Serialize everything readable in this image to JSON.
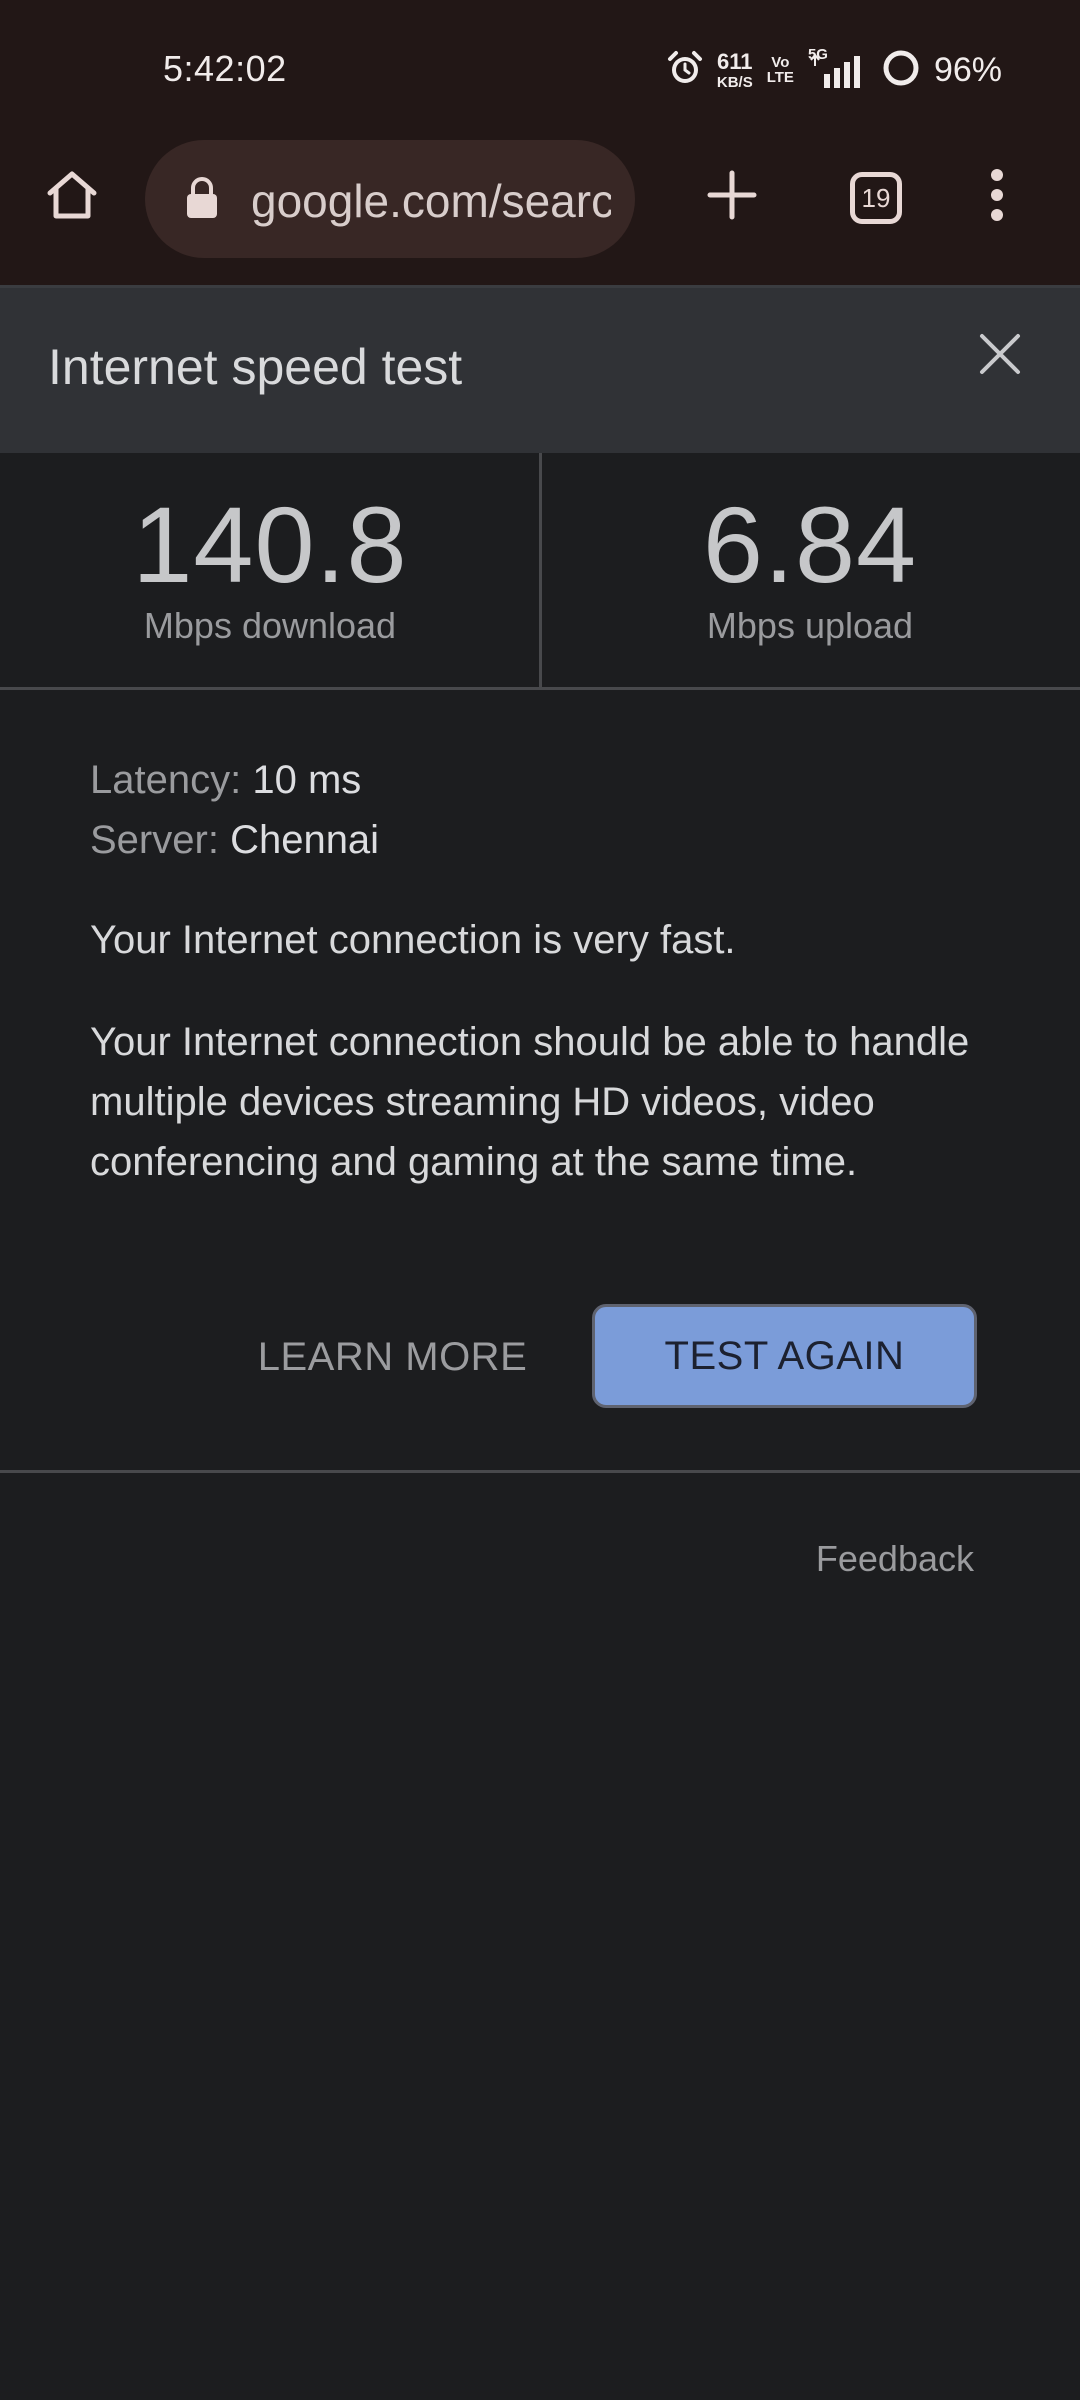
{
  "status_bar": {
    "time": "5:42:02",
    "net_speed_value": "611",
    "net_speed_unit": "KB/S",
    "volte_top": "Vo",
    "volte_bottom": "LTE",
    "network": "5G",
    "battery_percent": "96%",
    "icons": [
      "alarm-icon",
      "volte-icon",
      "signal-icon",
      "battery-ring-icon"
    ]
  },
  "toolbar": {
    "url": "google.com/search",
    "tab_count": "19",
    "icons": [
      "home-icon",
      "lock-icon",
      "new-tab-plus-icon",
      "more-vertical-icon"
    ]
  },
  "card": {
    "title": "Internet speed test",
    "download": {
      "value": "140.8",
      "label": "Mbps download"
    },
    "upload": {
      "value": "6.84",
      "label": "Mbps upload"
    },
    "latency_label": "Latency:",
    "latency_value": "10 ms",
    "server_label": "Server:",
    "server_value": "Chennai",
    "summary": "Your Internet connection is very fast.",
    "description": "Your Internet connection should be able to handle multiple devices streaming HD videos, video conferencing and gaming at the same time.",
    "learn_more": "LEARN MORE",
    "test_again": "TEST AGAIN",
    "feedback": "Feedback"
  },
  "colors": {
    "status_bg": "#221716",
    "urlbar_bg": "#382725",
    "card_header_bg": "#303236",
    "page_bg": "#1c1d1f",
    "accent_button": "#7b9cd9"
  }
}
